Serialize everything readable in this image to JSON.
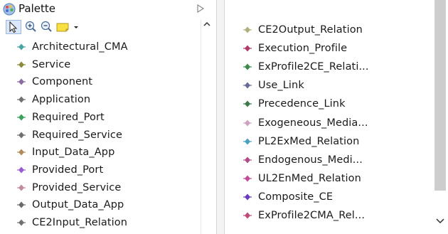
{
  "palette": {
    "title": "Palette",
    "tools": [
      {
        "name": "select-tool-icon"
      },
      {
        "name": "zoom-in-icon"
      },
      {
        "name": "zoom-out-icon"
      },
      {
        "name": "note-tool-icon"
      },
      {
        "name": "dropdown-arrow-icon"
      }
    ],
    "left_items": [
      {
        "label": "Architectural_CMA",
        "color": "#4aa3a3"
      },
      {
        "label": "Service",
        "color": "#8a8a3a"
      },
      {
        "label": "Component",
        "color": "#8a6aa0"
      },
      {
        "label": "Application",
        "color": "#707070"
      },
      {
        "label": "Required_Port",
        "color": "#3aa05a"
      },
      {
        "label": "Required_Service",
        "color": "#707070"
      },
      {
        "label": "Input_Data_App",
        "color": "#b08a5a"
      },
      {
        "label": "Provided_Port",
        "color": "#9a5ad0"
      },
      {
        "label": "Provided_Service",
        "color": "#c08aa0"
      },
      {
        "label": "Output_Data_App",
        "color": "#6a6a6a"
      },
      {
        "label": "CE2Input_Relation",
        "color": "#707070"
      }
    ],
    "right_items": [
      {
        "label": "CE2Output_Relation",
        "color": "#b0b07a"
      },
      {
        "label": "Execution_Profile",
        "color": "#b03a6a"
      },
      {
        "label": "ExProfile2CE_Relati...",
        "color": "#3a8a4a"
      },
      {
        "label": "Use_Link",
        "color": "#6a6a9a"
      },
      {
        "label": "Precedence_Link",
        "color": "#3a7a4a"
      },
      {
        "label": "Exogeneous_Media...",
        "color": "#d0a0c0"
      },
      {
        "label": "PL2ExMed_Relation",
        "color": "#4aa0c0"
      },
      {
        "label": "Endogenous_Medi...",
        "color": "#b04a8a"
      },
      {
        "label": "UL2EnMed_Relation",
        "color": "#c04a9a"
      },
      {
        "label": "Composite_CE",
        "color": "#6a3ac0"
      },
      {
        "label": "ExProfile2CMA_Rel...",
        "color": "#c04a7a"
      }
    ]
  }
}
